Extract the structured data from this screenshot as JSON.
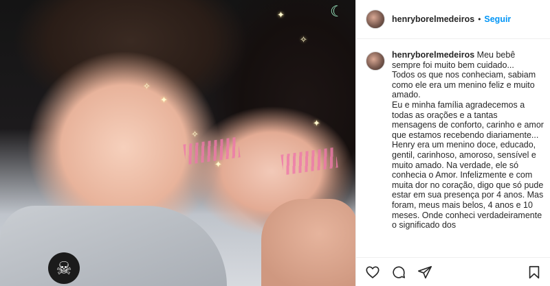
{
  "post": {
    "username": "henryborelmedeiros",
    "separator": "•",
    "follow_label": "Seguir",
    "caption": {
      "author": "henryborelmedeiros",
      "paragraphs": [
        "Meu bebê sempre foi muito bem cuidado...",
        "Todos os que nos conheciam, sabiam como ele era um menino feliz e muito amado.",
        "Eu e minha família agradecemos a todas as orações e a tantas mensagens de conforto, carinho e amor que estamos recebendo diariamente...",
        "Henry era um menino doce, educado, gentil, carinhoso, amoroso, sensível e muito amado. Na verdade, ele só conhecia o Amor. Infelizmente e com muita dor no coração, digo que só pude estar em sua presença por 4 anos. Mas foram, meus mais belos, 4 anos e 10 meses. Onde conheci verdadeiramente o significado dos"
      ]
    }
  },
  "icons": {
    "like": "heart-icon",
    "comment": "comment-icon",
    "share": "share-icon",
    "save": "bookmark-icon"
  },
  "colors": {
    "follow": "#0095f6",
    "text": "#262626",
    "border": "#efefef"
  }
}
